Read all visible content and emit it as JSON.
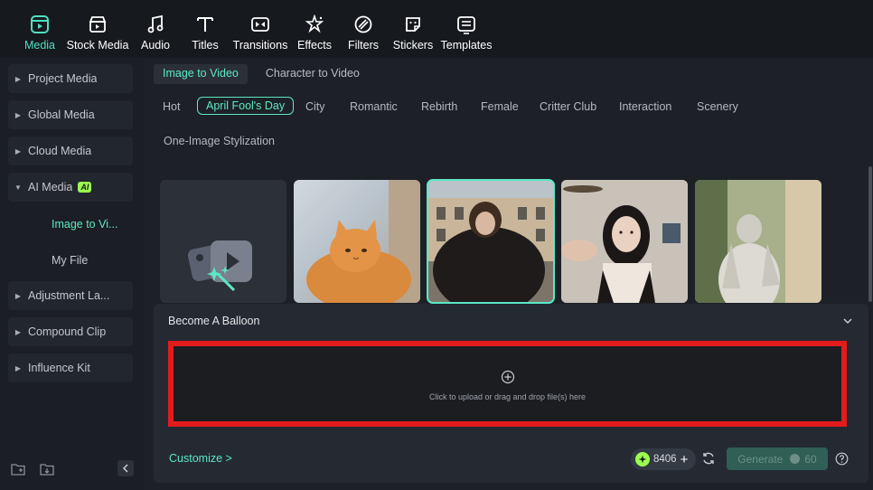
{
  "toolbar": {
    "items": [
      {
        "label": "Media",
        "icon": "media-icon",
        "active": true
      },
      {
        "label": "Stock Media",
        "icon": "stock-media-icon"
      },
      {
        "label": "Audio",
        "icon": "music-note-icon"
      },
      {
        "label": "Titles",
        "icon": "titles-icon"
      },
      {
        "label": "Transitions",
        "icon": "transitions-icon"
      },
      {
        "label": "Effects",
        "icon": "effects-icon"
      },
      {
        "label": "Filters",
        "icon": "filters-icon"
      },
      {
        "label": "Stickers",
        "icon": "stickers-icon"
      },
      {
        "label": "Templates",
        "icon": "templates-icon"
      }
    ]
  },
  "sidebar": {
    "items": [
      {
        "label": "Project Media"
      },
      {
        "label": "Global Media"
      },
      {
        "label": "Cloud Media"
      },
      {
        "label": "AI Media",
        "badge": "AI",
        "expanded": true
      },
      {
        "label": "Adjustment La..."
      },
      {
        "label": "Compound Clip"
      },
      {
        "label": "Influence Kit"
      }
    ],
    "sub_items": [
      {
        "label": "Image to Vi...",
        "active": true
      },
      {
        "label": "My File"
      }
    ]
  },
  "main": {
    "tabs": [
      {
        "label": "Image to Video",
        "active": true
      },
      {
        "label": "Character to Video"
      }
    ],
    "categories": [
      "Hot",
      "April Fool's Day",
      "City",
      "Romantic",
      "Rebirth",
      "Female",
      "Critter Club",
      "Interaction",
      "Scenery",
      "One-Image Stylization"
    ],
    "active_category": "April Fool's Day"
  },
  "panel": {
    "title": "Become A Balloon",
    "upload_text": "Click to upload or drag and drop file(s) here",
    "customize_label": "Customize >",
    "credits": "8406",
    "generate_label": "Generate",
    "generate_cost": "60"
  },
  "colors": {
    "accent": "#5be8c7",
    "highlight": "#e21c1c",
    "ai_badge": "#9cff4f"
  }
}
